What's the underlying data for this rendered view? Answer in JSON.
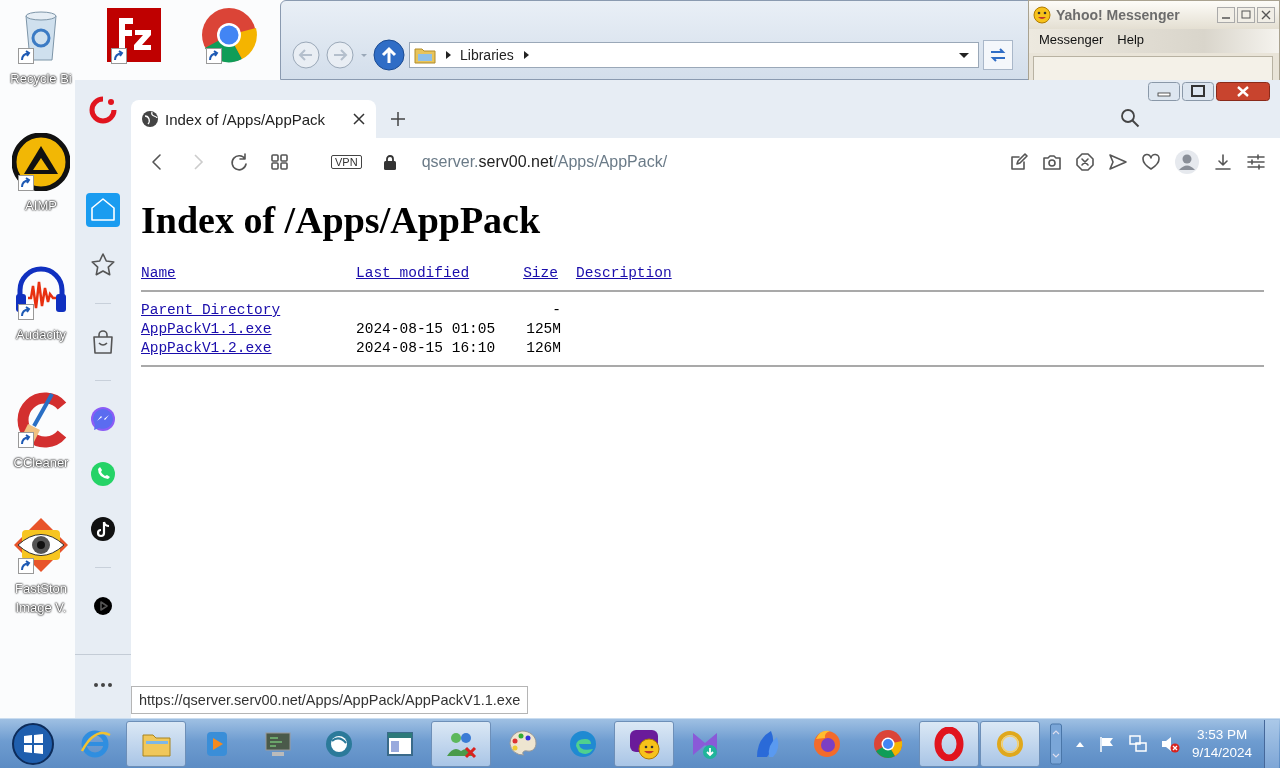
{
  "desktop": {
    "icons": [
      {
        "kind": "recycle",
        "label": "Recycle Bi"
      },
      {
        "kind": "filezilla"
      },
      {
        "kind": "chrome"
      },
      {
        "kind": "aimp",
        "label": "AIMP"
      },
      {
        "kind": "audacity",
        "label": "Audacity"
      },
      {
        "kind": "ccleaner",
        "label": "CCleaner"
      },
      {
        "kind": "faststone",
        "label": "FastSton Image V."
      }
    ]
  },
  "explorer": {
    "address": "Libraries"
  },
  "messenger": {
    "title": "Yahoo! Messenger",
    "menu": [
      "Messenger",
      "Help"
    ]
  },
  "browser": {
    "tab": {
      "title": "Index of /Apps/AppPack",
      "selected": true
    },
    "url": {
      "subdomain": "qserver.",
      "domain": "serv00.net",
      "path": "/Apps/AppPack/"
    },
    "vpn_badge": "VPN",
    "sidebar": [
      {
        "kind": "home",
        "selected": true
      },
      {
        "kind": "star",
        "selected": false
      },
      {
        "kind": "separator"
      },
      {
        "kind": "bag",
        "selected": false
      },
      {
        "kind": "separator"
      },
      {
        "kind": "messenger",
        "selected": false
      },
      {
        "kind": "whatsapp",
        "selected": false
      },
      {
        "kind": "tiktok",
        "selected": false
      },
      {
        "kind": "separator"
      },
      {
        "kind": "player",
        "selected": false
      }
    ],
    "page": {
      "heading": "Index of /Apps/AppPack",
      "columns": [
        "Name",
        "Last modified",
        "Size",
        "Description"
      ],
      "rows": [
        {
          "name": "Parent Directory",
          "size": "-"
        },
        {
          "name": "AppPackV1.1.exe",
          "modified": "2024-08-15 01:05",
          "size": "125M"
        },
        {
          "name": "AppPackV1.2.exe",
          "modified": "2024-08-15 16:10",
          "size": "126M"
        }
      ]
    },
    "status_url": "https://qserver.serv00.net/Apps/AppPack/AppPackV1.1.exe"
  },
  "taskbar": {
    "items": [
      {
        "kind": "ie",
        "active": false
      },
      {
        "kind": "explorer",
        "active": true
      },
      {
        "kind": "media",
        "active": false
      },
      {
        "kind": "monitor",
        "active": false
      },
      {
        "kind": "globe",
        "active": false
      },
      {
        "kind": "window",
        "active": false
      },
      {
        "kind": "people",
        "active": true
      },
      {
        "kind": "paint",
        "active": false
      },
      {
        "kind": "edge",
        "active": false
      },
      {
        "kind": "yahoo",
        "active": true
      },
      {
        "kind": "vs",
        "active": false
      },
      {
        "kind": "feather",
        "active": false
      },
      {
        "kind": "firefox",
        "active": false
      },
      {
        "kind": "chrome",
        "active": false
      },
      {
        "kind": "opera",
        "active": true
      },
      {
        "kind": "ring",
        "active": true
      }
    ],
    "time": "3:53 PM",
    "date": "9/14/2024"
  }
}
